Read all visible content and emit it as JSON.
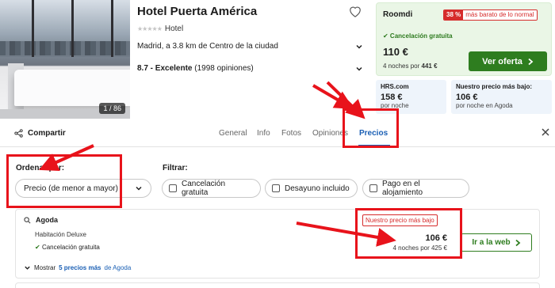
{
  "hotel": {
    "photo_counter": "1 / 86",
    "name": "Hotel Puerta América",
    "stars_text": "★★★★★",
    "category": "Hotel",
    "location": "Madrid, a 3.8 km de Centro de la ciudad",
    "rating_score": "8.7 - Excelente",
    "rating_reviews": "(1998 opiniones)"
  },
  "deal": {
    "provider": "Roomdi",
    "badge_pct": "38 %",
    "badge_text": "más barato de lo normal",
    "cancel": "✔ Cancelación gratuita",
    "price": "110 €",
    "nights_prefix": "4 noches por",
    "nights_total": "441 €",
    "cta": "Ver oferta"
  },
  "mini_offers": [
    {
      "provider": "HRS.com",
      "price": "158 €",
      "sub": "por noche"
    },
    {
      "provider": "Nuestro precio más bajo:",
      "price": "106 €",
      "sub": "por noche en Agoda"
    }
  ],
  "tabs": {
    "share": "Compartir",
    "items": [
      "General",
      "Info",
      "Fotos",
      "Opiniones",
      "Precios"
    ],
    "active": "Precios"
  },
  "sort": {
    "label": "Ordenar por:",
    "value": "Precio (de menor a mayor)"
  },
  "filter": {
    "label": "Filtrar:",
    "options": [
      "Cancelación gratuita",
      "Desayuno incluido",
      "Pago en el alojamiento"
    ]
  },
  "offer": {
    "provider": "Agoda",
    "room": "Habitación Deluxe",
    "cancel": "Cancelación gratuita",
    "more_prefix": "Mostrar",
    "more_bold": "5 precios más",
    "more_suffix": "de Agoda",
    "badge": "Nuestro precio más bajo",
    "price": "106 €",
    "nights": "4 noches por 425 €",
    "cta": "Ir a la web"
  },
  "colors": {
    "accent_blue": "#1a5fb4",
    "deal_green": "#2e7d1f",
    "annotation_red": "#e8131b",
    "badge_red": "#d62c2c"
  }
}
